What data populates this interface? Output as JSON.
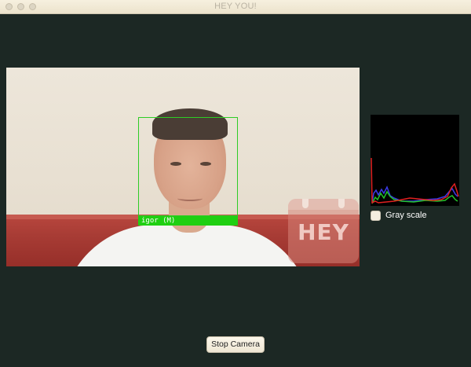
{
  "window": {
    "title": "HEY YOU!"
  },
  "camera": {
    "face_label": "igor (M)",
    "watermark_text": "HEY",
    "box_color": "#2ecc25"
  },
  "histogram": {
    "channels": [
      "red",
      "green",
      "blue"
    ],
    "colors": {
      "red": "#e02020",
      "green": "#22c22a",
      "blue": "#3a3ae8"
    },
    "background": "#000000"
  },
  "controls": {
    "gray_scale_label": "Gray scale",
    "gray_scale_checked": false,
    "stop_camera_label": "Stop Camera"
  }
}
